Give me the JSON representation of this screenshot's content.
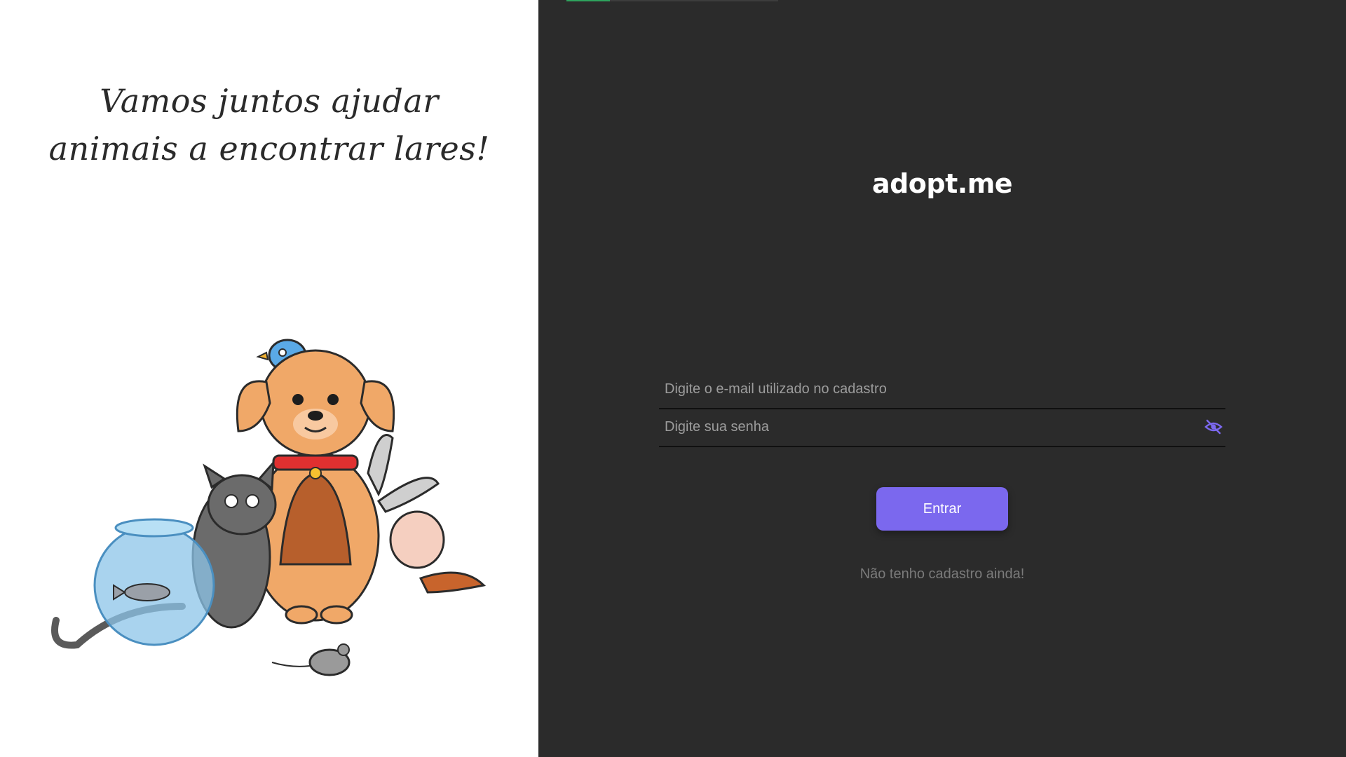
{
  "left_panel": {
    "tagline_line1": "Vamos juntos ajudar",
    "tagline_line2": "animais a encontrar lares!"
  },
  "right_panel": {
    "brand": "adopt.me",
    "email_placeholder": "Digite o e-mail utilizado no cadastro",
    "password_placeholder": "Digite sua senha",
    "visibility_icon": "eye-off-icon",
    "submit_label": "Entrar",
    "register_link": "Não tenho cadastro ainda!"
  },
  "colors": {
    "accent": "#7b68ee",
    "left_bg": "#ffffff",
    "right_bg": "#2b2b2b",
    "progress": "#2ea35d"
  }
}
